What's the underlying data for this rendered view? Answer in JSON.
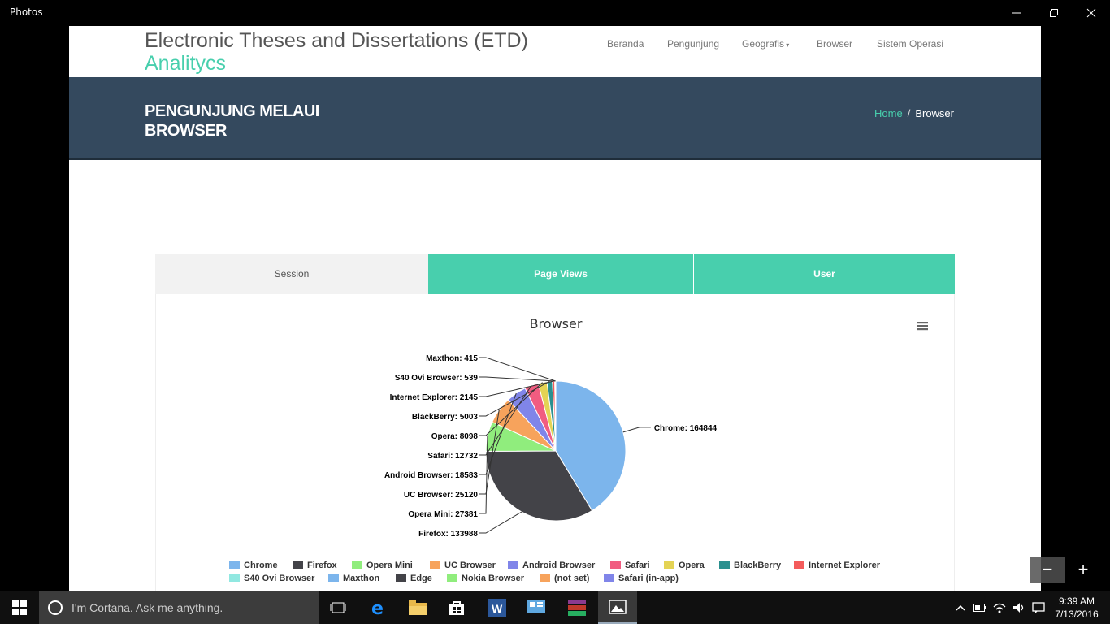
{
  "window": {
    "app_title": "Photos",
    "minimize_icon": "minimize-icon",
    "restore_icon": "restore-icon",
    "close_icon": "close-icon"
  },
  "site": {
    "title": "Electronic Theses and Dissertations (ETD)",
    "subtitle": "Analitycs",
    "nav": [
      "Beranda",
      "Pengunjung",
      "Geografis",
      "Browser",
      "Sistem Operasi"
    ],
    "banner_title": "PENGUNJUNG MELAUI BROWSER",
    "breadcrumb_home": "Home",
    "breadcrumb_sep": "/",
    "breadcrumb_current": "Browser",
    "accent": "#48cfad",
    "banner_color": "#34495e"
  },
  "tabs": [
    "Session",
    "Page Views",
    "User"
  ],
  "chart_data": {
    "type": "pie",
    "title": "Browser",
    "slices": [
      {
        "label": "Chrome",
        "value": 164844,
        "color": "#7cb5ec"
      },
      {
        "label": "Firefox",
        "value": 133988,
        "color": "#434348"
      },
      {
        "label": "Opera Mini",
        "value": 27381,
        "color": "#90ed7d"
      },
      {
        "label": "UC Browser",
        "value": 25120,
        "color": "#f7a35c"
      },
      {
        "label": "Android Browser",
        "value": 18583,
        "color": "#8085e9"
      },
      {
        "label": "Safari",
        "value": 12732,
        "color": "#f15c80"
      },
      {
        "label": "Opera",
        "value": 8098,
        "color": "#e4d354"
      },
      {
        "label": "BlackBerry",
        "value": 5003,
        "color": "#2b908f"
      },
      {
        "label": "Internet Explorer",
        "value": 2145,
        "color": "#f45b5b"
      },
      {
        "label": "S40 Ovi Browser",
        "value": 539,
        "color": "#91e8e1"
      },
      {
        "label": "Maxthon",
        "value": 415,
        "color": "#7cb5ec"
      }
    ],
    "legend": [
      {
        "label": "Chrome",
        "color": "#7cb5ec"
      },
      {
        "label": "Firefox",
        "color": "#434348"
      },
      {
        "label": "Opera Mini",
        "color": "#90ed7d"
      },
      {
        "label": "UC Browser",
        "color": "#f7a35c"
      },
      {
        "label": "Android Browser",
        "color": "#8085e9"
      },
      {
        "label": "Safari",
        "color": "#f15c80"
      },
      {
        "label": "Opera",
        "color": "#e4d354"
      },
      {
        "label": "BlackBerry",
        "color": "#2b908f"
      },
      {
        "label": "Internet Explorer",
        "color": "#f45b5b"
      },
      {
        "label": "S40 Ovi Browser",
        "color": "#91e8e1"
      },
      {
        "label": "Maxthon",
        "color": "#7cb5ec"
      },
      {
        "label": "Edge",
        "color": "#434348"
      },
      {
        "label": "Nokia Browser",
        "color": "#90ed7d"
      },
      {
        "label": "(not set)",
        "color": "#f7a35c"
      },
      {
        "label": "Safari (in-app)",
        "color": "#8085e9"
      }
    ],
    "legend_placement": "bottom",
    "menu_icon": "hamburger-menu-icon"
  },
  "photos_controls": {
    "zoom_out": "−",
    "zoom_in": "+"
  },
  "taskbar": {
    "cortana_placeholder": "I'm Cortana. Ask me anything.",
    "apps": [
      "task-view",
      "edge",
      "file-explorer",
      "store",
      "word",
      "control-panel",
      "winrar",
      "photos"
    ],
    "time": "9:39 AM",
    "date": "7/13/2016"
  }
}
